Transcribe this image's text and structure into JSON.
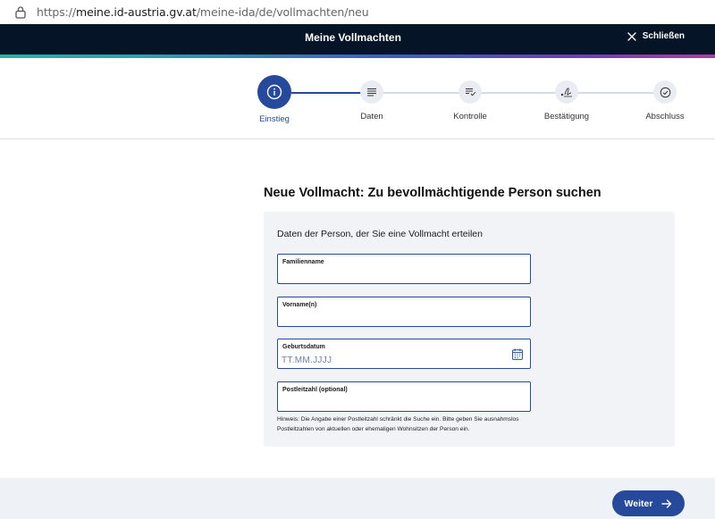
{
  "browser": {
    "url_scheme": "https://",
    "url_host": "meine.id-austria.gv.at",
    "url_path": "/meine-ida/de/vollmachten/neu"
  },
  "header": {
    "title": "Meine Vollmachten",
    "close_label": "Schließen"
  },
  "stepper": {
    "steps": [
      {
        "label": "Einstieg",
        "icon": "info-icon",
        "active": true
      },
      {
        "label": "Daten",
        "icon": "list-icon",
        "active": false
      },
      {
        "label": "Kontrolle",
        "icon": "checklist-icon",
        "active": false
      },
      {
        "label": "Bestätigung",
        "icon": "signature-icon",
        "active": false
      },
      {
        "label": "Abschluss",
        "icon": "check-circle-icon",
        "active": false
      }
    ]
  },
  "main": {
    "heading": "Neue Vollmacht: Zu bevollmächtigende Person suchen",
    "intro": "Daten der Person, der Sie eine Vollmacht erteilen",
    "fields": {
      "lastname": {
        "label": "Familienname",
        "value": ""
      },
      "firstname": {
        "label": "Vorname(n)",
        "value": ""
      },
      "birthdate": {
        "label": "Geburtsdatum",
        "placeholder": "TT.MM.JJJJ",
        "value": ""
      },
      "postcode": {
        "label": "Postleitzahl (optional)",
        "value": ""
      }
    },
    "hint_line1": "Hinweis: Die Angabe einer Postleitzahl schränkt die Suche ein. Bitte geben Sie ausnahmslos",
    "hint_line2": "Postleitzahlen von aktuellen oder ehemaligen Wohnsitzen der Person ein."
  },
  "footer": {
    "next_label": "Weiter"
  },
  "colors": {
    "primary": "#26499c",
    "header_bg": "#061428",
    "panel_bg": "#f1f3f7"
  }
}
